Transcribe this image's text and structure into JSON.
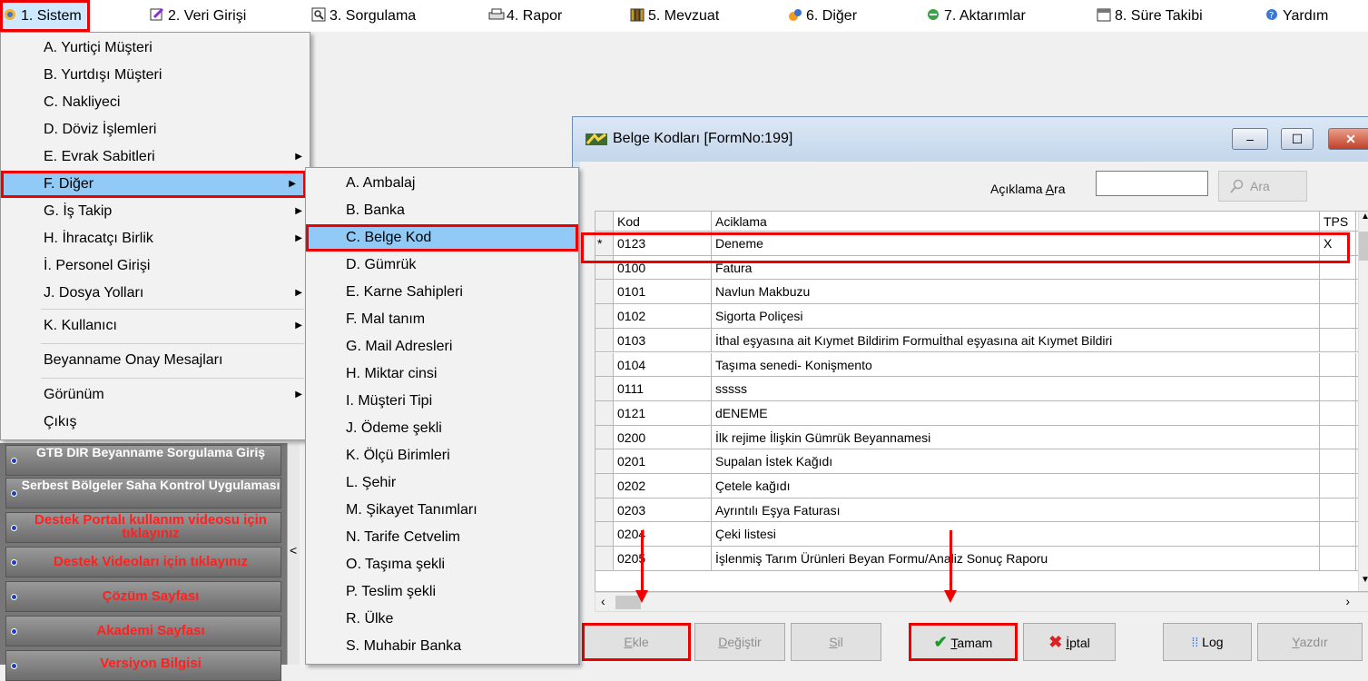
{
  "menubar": {
    "items": [
      {
        "label": "1.  Sistem",
        "icon": "system-icon"
      },
      {
        "label": "2.  Veri Girişi",
        "icon": "data-entry-icon"
      },
      {
        "label": "3.  Sorgulama",
        "icon": "query-icon"
      },
      {
        "label": "4.  Rapor",
        "icon": "printer-icon"
      },
      {
        "label": "5.  Mevzuat",
        "icon": "books-icon"
      },
      {
        "label": "6.  Diğer",
        "icon": "other-icon"
      },
      {
        "label": "7.  Aktarımlar",
        "icon": "transfer-icon"
      },
      {
        "label": "8. Süre Takibi",
        "icon": "calendar-icon"
      },
      {
        "label": "Yardım",
        "icon": "help-icon"
      }
    ]
  },
  "sistem_menu": {
    "items": [
      {
        "label": "A.  Yurtiçi Müşteri"
      },
      {
        "label": "B.  Yurtdışı Müşteri"
      },
      {
        "label": "C.  Nakliyeci"
      },
      {
        "label": "D.   Döviz İşlemleri"
      },
      {
        "label": "E.  Evrak Sabitleri"
      },
      {
        "label": "F.  Diğer"
      },
      {
        "label": "G.  İş Takip"
      },
      {
        "label": "H.  İhracatçı Birlik"
      },
      {
        "label": "İ.   Personel Girişi"
      },
      {
        "label": "J.  Dosya Yolları"
      },
      {
        "label": "K.  Kullanıcı"
      },
      {
        "label": "Beyanname Onay Mesajları"
      },
      {
        "label": "Görünüm"
      },
      {
        "label": "Çıkış"
      }
    ]
  },
  "diger_menu": {
    "items": [
      {
        "label": "A.  Ambalaj"
      },
      {
        "label": "B.  Banka"
      },
      {
        "label": "C.  Belge Kod"
      },
      {
        "label": "D.  Gümrük"
      },
      {
        "label": "E.  Karne Sahipleri"
      },
      {
        "label": "F.  Mal tanım"
      },
      {
        "label": "G.  Mail Adresleri"
      },
      {
        "label": "H.  Miktar cinsi"
      },
      {
        "label": "I.  Müşteri Tipi"
      },
      {
        "label": "J.  Ödeme şekli"
      },
      {
        "label": "K.  Ölçü Birimleri"
      },
      {
        "label": "L.  Şehir"
      },
      {
        "label": "M.  Şikayet Tanımları"
      },
      {
        "label": "N.  Tarife Cetvelim"
      },
      {
        "label": "O.  Taşıma şekli"
      },
      {
        "label": "P.  Teslim şekli"
      },
      {
        "label": "R.  Ülke"
      },
      {
        "label": "S.  Muhabir Banka"
      }
    ]
  },
  "side_panel": {
    "buttons": [
      {
        "label": "GTB DIR Beyanname Sorgulama Giriş",
        "red": false
      },
      {
        "label": "Serbest Bölgeler Saha Kontrol Uygulaması",
        "red": false
      },
      {
        "label": "Destek Portalı kullanım videosu için tıklayınız",
        "red": true
      },
      {
        "label": "Destek Videoları için tıklayınız",
        "red": true
      },
      {
        "label": "Çözüm Sayfası",
        "red": true
      },
      {
        "label": "Akademi Sayfası",
        "red": true
      },
      {
        "label": "Versiyon Bilgisi",
        "red": true
      }
    ],
    "collapse": "<"
  },
  "window": {
    "title": "Belge Kodları [FormNo:199]",
    "min": "–",
    "max": "☐",
    "close": "✕",
    "search_label_pre": "Açıklama ",
    "search_label_u": "A",
    "search_label_post": "ra",
    "search_value": "",
    "search_button": "Ara"
  },
  "grid": {
    "columns": {
      "kod": "Kod",
      "aciklama": "Aciklama",
      "tps": "TPS"
    },
    "rows": [
      {
        "ind": "*",
        "kod": "0123",
        "aciklama": "Deneme",
        "tps": "X"
      },
      {
        "ind": "",
        "kod": "0100",
        "aciklama": "Fatura",
        "tps": ""
      },
      {
        "ind": "",
        "kod": "0101",
        "aciklama": "Navlun Makbuzu",
        "tps": ""
      },
      {
        "ind": "",
        "kod": "0102",
        "aciklama": "Sigorta Poliçesi",
        "tps": ""
      },
      {
        "ind": "",
        "kod": "0103",
        "aciklama": "İthal eşyasına ait Kıymet Bildirim Formuİthal eşyasına ait Kıymet Bildiri",
        "tps": ""
      },
      {
        "ind": "",
        "kod": "0104",
        "aciklama": "Taşıma senedi- Konişmento",
        "tps": ""
      },
      {
        "ind": "",
        "kod": "0111",
        "aciklama": "sssss",
        "tps": ""
      },
      {
        "ind": "",
        "kod": "0121",
        "aciklama": "dENEME",
        "tps": ""
      },
      {
        "ind": "",
        "kod": "0200",
        "aciklama": "İlk rejime İlişkin Gümrük Beyannamesi",
        "tps": ""
      },
      {
        "ind": "",
        "kod": "0201",
        "aciklama": "Supalan İstek Kağıdı",
        "tps": ""
      },
      {
        "ind": "",
        "kod": "0202",
        "aciklama": "Çetele kağıdı",
        "tps": ""
      },
      {
        "ind": "",
        "kod": "0203",
        "aciklama": "Ayrıntılı Eşya Faturası",
        "tps": ""
      },
      {
        "ind": "",
        "kod": "0204",
        "aciklama": "Çeki listesi",
        "tps": ""
      },
      {
        "ind": "",
        "kod": "0205",
        "aciklama": "İşlenmiş Tarım Ürünleri Beyan Formu/Analiz Sonuç Raporu",
        "tps": ""
      }
    ]
  },
  "buttons": {
    "ekle": {
      "u": "E",
      "rest": "kle"
    },
    "degistir": {
      "u": "D",
      "rest": "eğiştir"
    },
    "sil": {
      "u": "S",
      "rest": "il"
    },
    "tamam": {
      "u": "T",
      "rest": "amam"
    },
    "iptal": {
      "u": "İ",
      "rest": "ptal"
    },
    "log": {
      "label": "Log"
    },
    "yazdir": {
      "u": "Y",
      "rest": "azdır"
    }
  },
  "colors": {
    "highlight": "#e00000",
    "selection": "#91c9f7"
  }
}
